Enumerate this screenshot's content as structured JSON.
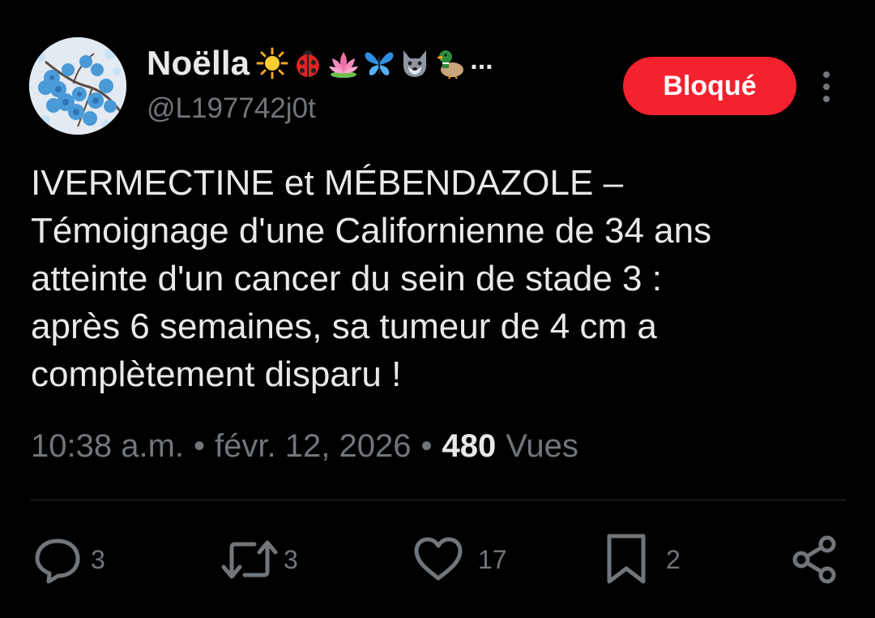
{
  "user": {
    "display_name": "Noëlla",
    "name_emojis": [
      "sun-emoji",
      "ladybug-emoji",
      "lotus-emoji",
      "butterfly-emoji",
      "wolf-emoji",
      "duck-emoji"
    ],
    "ellipsis": "...",
    "handle": "@L197742j0t"
  },
  "header": {
    "blocked_label": "Bloqué"
  },
  "tweet": {
    "text": "IVERMECTINE et MÉBENDAZOLE –\nTémoignage d'une Californienne de 34 ans\natteinte d'un cancer du sein de stade 3 :\naprès 6 semaines, sa tumeur de 4 cm a\ncomplètement disparu !"
  },
  "meta": {
    "time": "10:38 a.m.",
    "separator": "•",
    "date": "févr. 12, 2026",
    "views_count": "480",
    "views_label": "Vues"
  },
  "actions": {
    "reply": {
      "icon": "reply-icon",
      "count": "3"
    },
    "retweet": {
      "icon": "retweet-icon",
      "count": "3"
    },
    "like": {
      "icon": "heart-icon",
      "count": "17"
    },
    "bookmark": {
      "icon": "bookmark-icon",
      "count": "2"
    },
    "share": {
      "icon": "share-icon"
    }
  },
  "colors": {
    "background": "#000000",
    "text_primary": "#e7e9ea",
    "text_secondary": "#71767b",
    "blocked_red": "#f4212e",
    "divider": "#2f3336"
  }
}
